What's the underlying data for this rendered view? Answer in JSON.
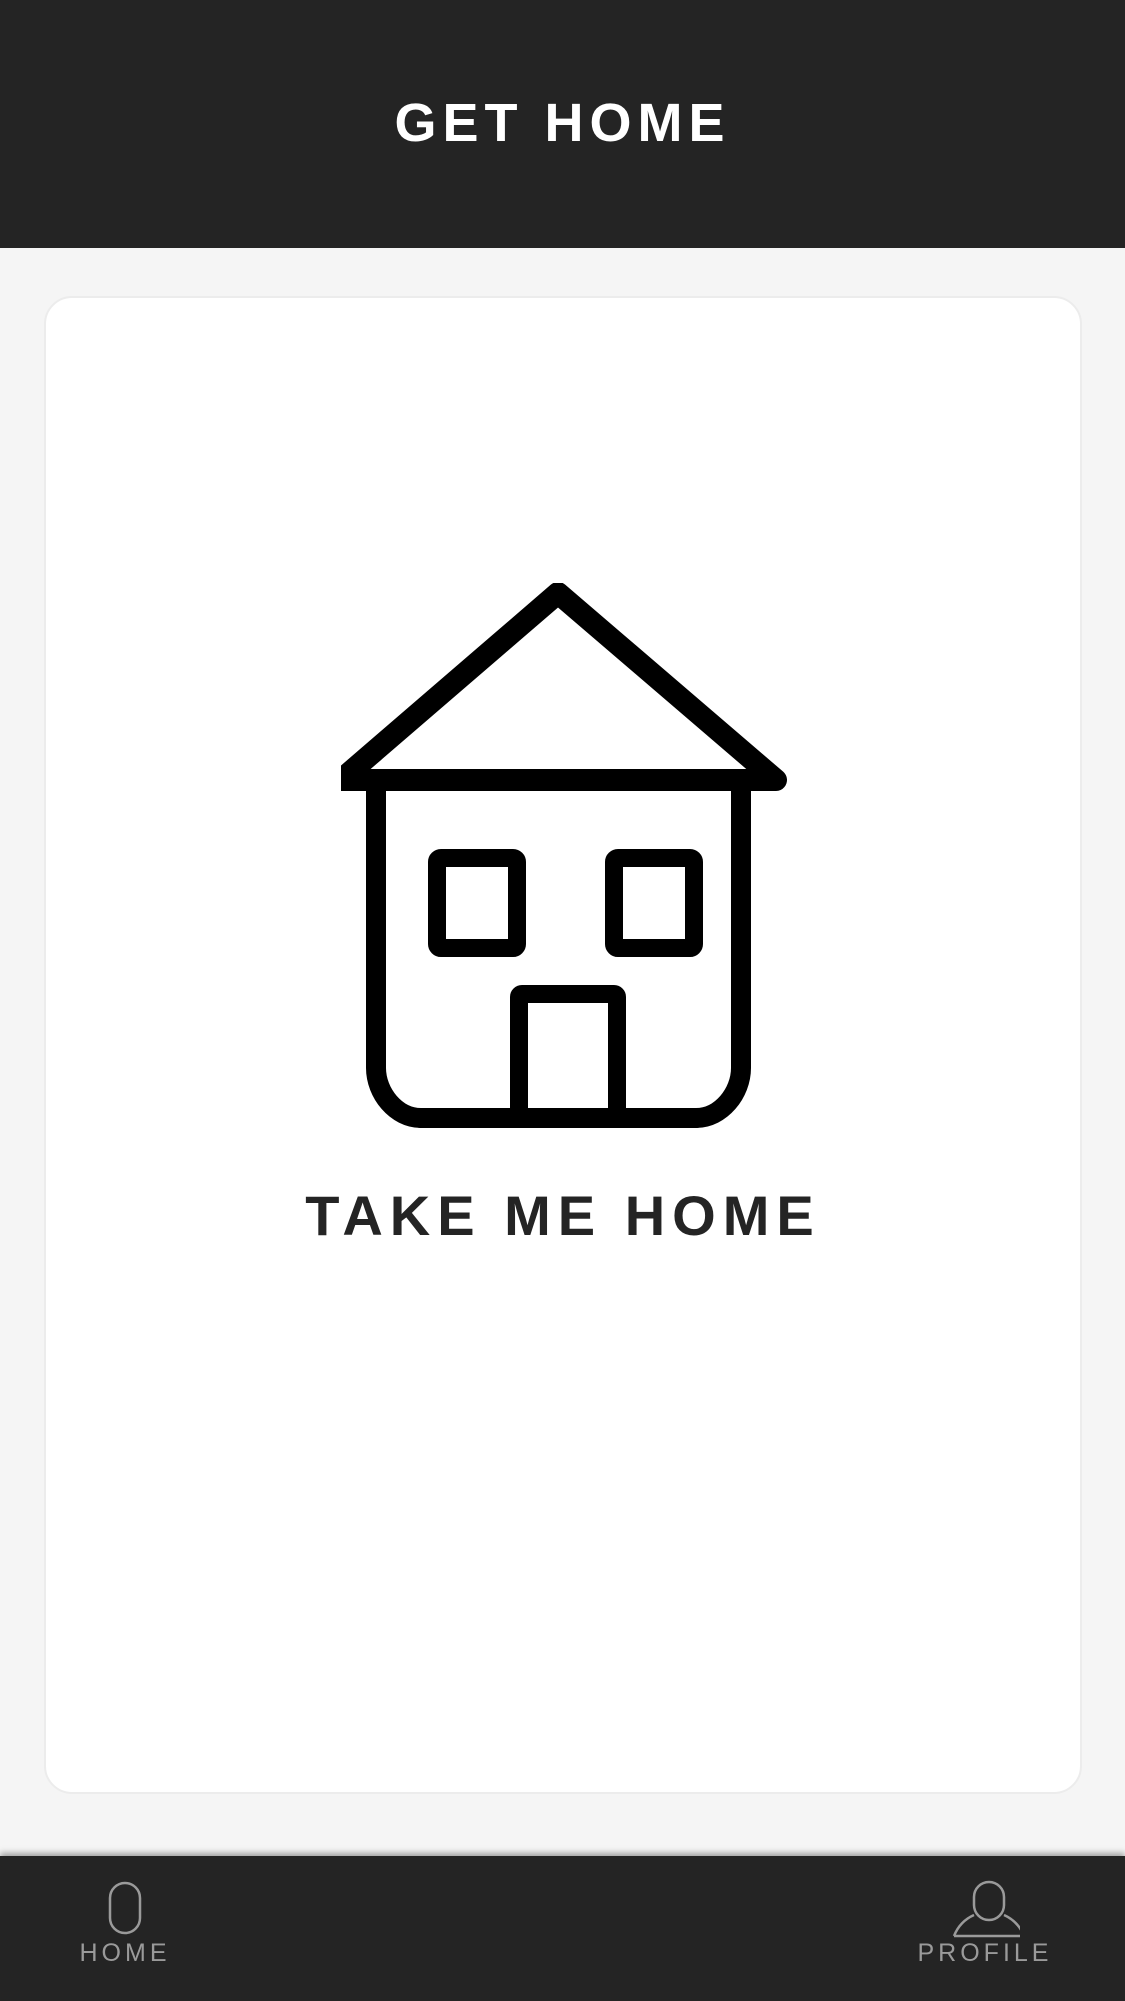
{
  "header": {
    "title": "GET HOME"
  },
  "main": {
    "house_icon": "house-icon",
    "action_label": "TAKE ME HOME"
  },
  "tab_bar": {
    "items": [
      {
        "label": "HOME",
        "icon": "home-tab-icon"
      },
      {
        "label": "PROFILE",
        "icon": "profile-icon"
      }
    ]
  },
  "colors": {
    "header_background": "#242424",
    "page_background": "#f5f5f5",
    "card_background": "#ffffff",
    "text_primary": "#242424",
    "tab_inactive": "#9a9a9a"
  }
}
